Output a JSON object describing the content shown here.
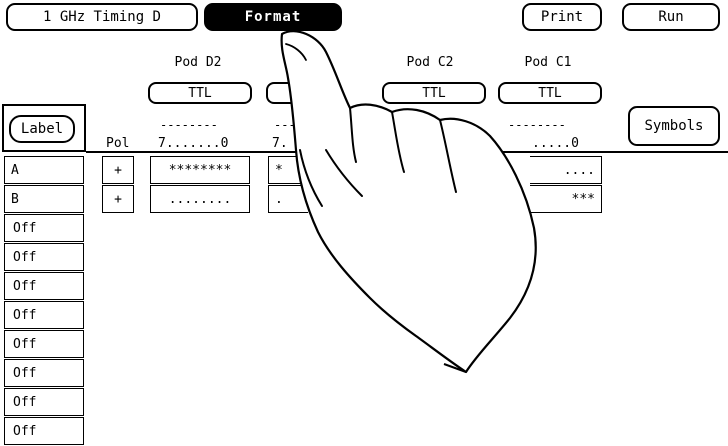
{
  "top_bar": {
    "mode_label": "1 GHz Timing D",
    "format_label": "Format",
    "print_label": "Print",
    "run_label": "Run"
  },
  "pods": [
    {
      "name": "Pod D2",
      "threshold": "TTL",
      "bits": "7.......0",
      "dashes": "--------"
    },
    {
      "name": "",
      "threshold": "",
      "bits": "7.",
      "dashes": "---"
    },
    {
      "name": "Pod C2",
      "threshold": "TTL",
      "bits": "",
      "dashes": ""
    },
    {
      "name": "Pod C1",
      "threshold": "TTL",
      "bits": ".....0",
      "dashes": "--------"
    }
  ],
  "symbols_label": "Symbols",
  "label_header": "Label",
  "pol_header": "Pol",
  "rows": [
    {
      "label": "A",
      "pol": "+",
      "d2": "********",
      "col2": "*",
      "c1": "...."
    },
    {
      "label": "B",
      "pol": "+",
      "d2": "........",
      "col2": ".",
      "c1": "***"
    },
    {
      "label": "Off"
    },
    {
      "label": "Off"
    },
    {
      "label": "Off"
    },
    {
      "label": "Off"
    },
    {
      "label": "Off"
    },
    {
      "label": "Off"
    },
    {
      "label": "Off"
    },
    {
      "label": "Off"
    }
  ]
}
